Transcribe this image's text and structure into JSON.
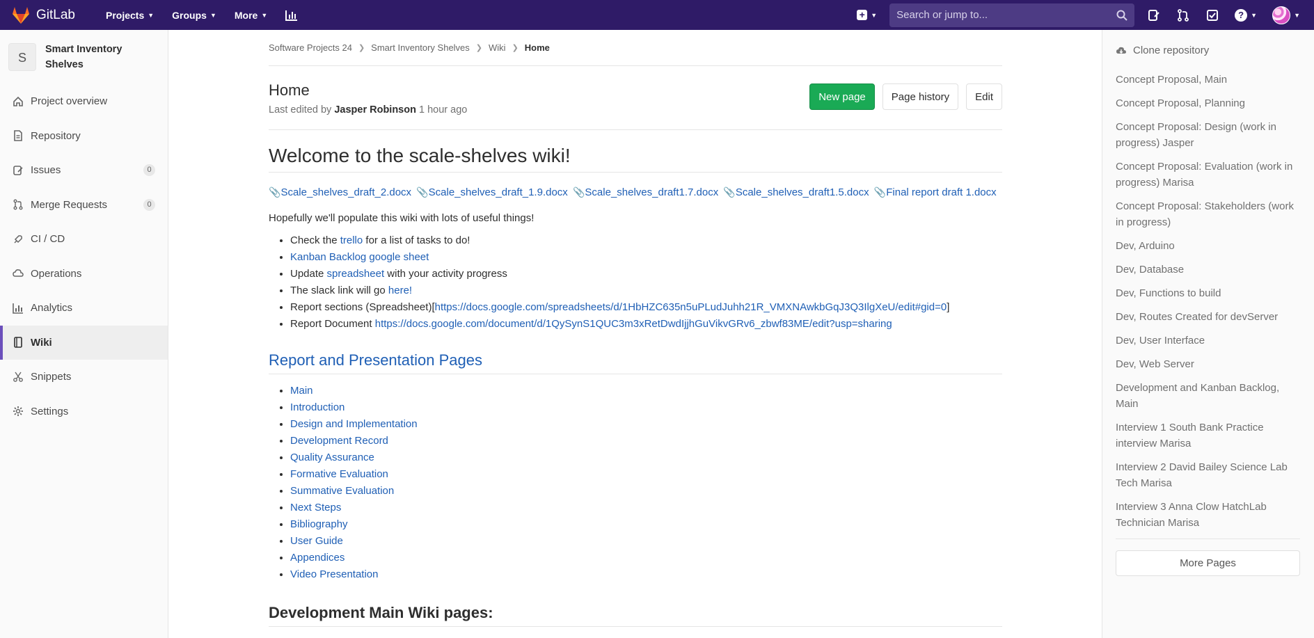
{
  "navbar": {
    "brand": "GitLab",
    "menus": [
      {
        "label": "Projects"
      },
      {
        "label": "Groups"
      },
      {
        "label": "More"
      }
    ],
    "search_placeholder": "Search or jump to...",
    "accent_color": "#2f1b67"
  },
  "sidebar": {
    "project_letter": "S",
    "project_name": "Smart Inventory Shelves",
    "items": [
      {
        "label": "Project overview",
        "icon": "home-icon"
      },
      {
        "label": "Repository",
        "icon": "doc-icon"
      },
      {
        "label": "Issues",
        "icon": "issues-icon",
        "count": "0"
      },
      {
        "label": "Merge Requests",
        "icon": "merge-request-icon",
        "count": "0"
      },
      {
        "label": "CI / CD",
        "icon": "rocket-icon"
      },
      {
        "label": "Operations",
        "icon": "cloud-icon"
      },
      {
        "label": "Analytics",
        "icon": "chart-icon"
      },
      {
        "label": "Wiki",
        "icon": "book-icon",
        "active": true
      },
      {
        "label": "Snippets",
        "icon": "scissors-icon"
      },
      {
        "label": "Settings",
        "icon": "gear-icon"
      }
    ]
  },
  "breadcrumb": [
    "Software Projects 24",
    "Smart Inventory Shelves",
    "Wiki",
    "Home"
  ],
  "page": {
    "title": "Home",
    "meta_prefix": "Last edited by",
    "author": "Jasper Robinson",
    "time": "1 hour ago",
    "buttons": {
      "new_page": "New page",
      "history": "Page history",
      "edit": "Edit"
    }
  },
  "wiki": {
    "heading": "Welcome to the scale-shelves wiki!",
    "files": [
      "Scale_shelves_draft_2.docx",
      "Scale_shelves_draft_1.9.docx",
      "Scale_shelves_draft1.7.docx",
      "Scale_shelves_draft1.5.docx",
      "Final report draft 1.docx"
    ],
    "intro": "Hopefully we'll populate this wiki with lots of useful things!",
    "bullets": {
      "b1_pre": "Check the",
      "b1_link": "trello",
      "b1_post": "for a list of tasks to do!",
      "b2_link": "Kanban Backlog google sheet",
      "b3_pre": "Update",
      "b3_link": "spreadsheet",
      "b3_post": "with your activity progress",
      "b4_pre": "The slack link will go",
      "b4_link": "here!",
      "b5_pre": "Report sections (Spreadsheet)[",
      "b5_link": "https://docs.google.com/spreadsheets/d/1HbHZC635n5uPLudJuhh21R_VMXNAwkbGqJ3Q3IlgXeU/edit#gid=0",
      "b5_post": "]",
      "b6_pre": "Report Document",
      "b6_link": "https://docs.google.com/document/d/1QySynS1QUC3m3xRetDwdIjjhGuVikvGRv6_zbwf83ME/edit?usp=sharing"
    },
    "section_title": "Report and Presentation Pages",
    "report_pages": [
      "Main",
      "Introduction",
      "Design and Implementation",
      "Development Record",
      "Quality Assurance",
      "Formative Evaluation",
      "Summative Evaluation",
      "Next Steps",
      "Bibliography",
      "User Guide",
      "Appendices",
      "Video Presentation"
    ],
    "dev_heading": "Development Main Wiki pages:"
  },
  "right_sidebar": {
    "clone_label": "Clone repository",
    "pages": [
      "Concept Proposal, Main",
      "Concept Proposal, Planning",
      "Concept Proposal: Design (work in progress) Jasper",
      "Concept Proposal: Evaluation (work in progress) Marisa",
      "Concept Proposal: Stakeholders (work in progress)",
      "Dev, Arduino",
      "Dev, Database",
      "Dev, Functions to build",
      "Dev, Routes Created for devServer",
      "Dev, User Interface",
      "Dev, Web Server",
      "Development and Kanban Backlog, Main",
      "Interview 1 South Bank Practice interview Marisa",
      "Interview 2 David Bailey Science Lab Tech Marisa",
      "Interview 3 Anna Clow HatchLab Technician Marisa"
    ],
    "more_label": "More Pages"
  }
}
